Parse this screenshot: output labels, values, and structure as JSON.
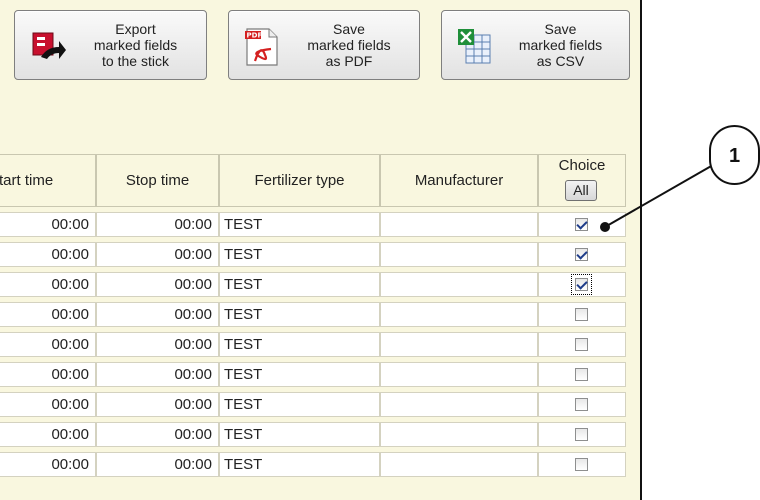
{
  "toolbar": {
    "export_label": "Export\nmarked fields\nto the stick",
    "pdf_label": "Save\nmarked fields\nas PDF",
    "csv_label": "Save\nmarked fields\nas CSV",
    "export_icon": "usb-export-icon",
    "pdf_icon": "pdf-file-icon",
    "csv_icon": "excel-file-icon"
  },
  "table": {
    "columns": [
      "tart time",
      "Stop time",
      "Fertilizer type",
      "Manufacturer",
      "Choice"
    ],
    "all_button": "All",
    "rows": [
      {
        "start": "00:00",
        "stop": "00:00",
        "fert": "TEST",
        "manu": "",
        "checked": true
      },
      {
        "start": "00:00",
        "stop": "00:00",
        "fert": "TEST",
        "manu": "",
        "checked": true
      },
      {
        "start": "00:00",
        "stop": "00:00",
        "fert": "TEST",
        "manu": "",
        "checked": true
      },
      {
        "start": "00:00",
        "stop": "00:00",
        "fert": "TEST",
        "manu": "",
        "checked": false
      },
      {
        "start": "00:00",
        "stop": "00:00",
        "fert": "TEST",
        "manu": "",
        "checked": false
      },
      {
        "start": "00:00",
        "stop": "00:00",
        "fert": "TEST",
        "manu": "",
        "checked": false
      },
      {
        "start": "00:00",
        "stop": "00:00",
        "fert": "TEST",
        "manu": "",
        "checked": false
      },
      {
        "start": "00:00",
        "stop": "00:00",
        "fert": "TEST",
        "manu": "",
        "checked": false
      },
      {
        "start": "00:00",
        "stop": "00:00",
        "fert": "TEST",
        "manu": "",
        "checked": false
      }
    ]
  },
  "callout": {
    "label": "1"
  },
  "colors": {
    "panel_bg": "#f9f7df",
    "check_mark": "#1f3d8a"
  }
}
